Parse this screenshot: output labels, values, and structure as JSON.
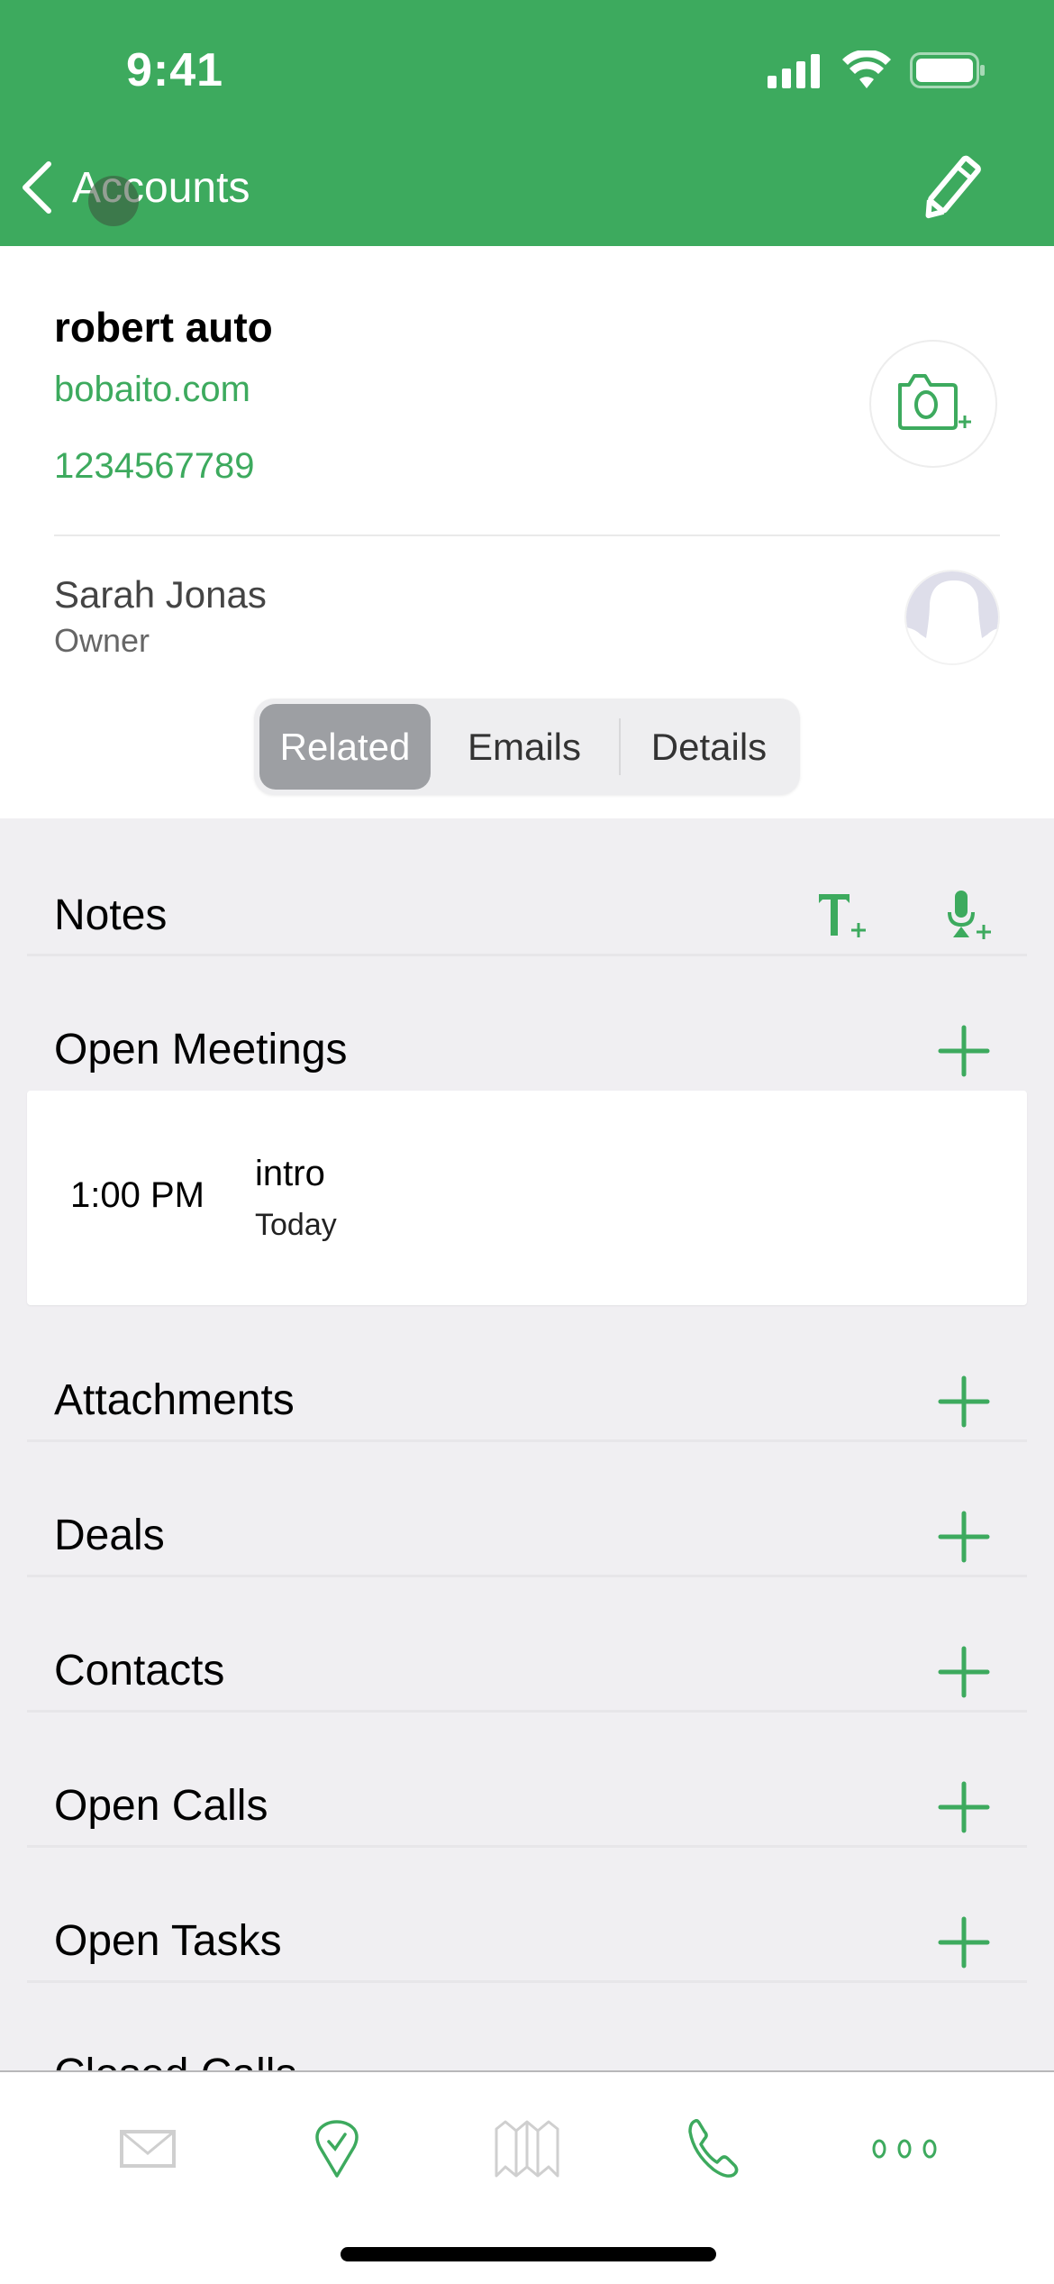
{
  "colors": {
    "brand": "#3DAA5E",
    "background": "#F0EFF2",
    "inactive_icon": "#CFCFCF"
  },
  "status_bar": {
    "time": "9:41",
    "icons": [
      "cellular-signal-icon",
      "wifi-icon",
      "battery-icon"
    ]
  },
  "nav": {
    "back_label": "Accounts",
    "edit_icon": "pencil-icon"
  },
  "account": {
    "name": "robert auto",
    "website": "bobaito.com",
    "phone": "1234567789",
    "photo_button_icon": "camera-add-icon"
  },
  "owner": {
    "name": "Sarah Jonas",
    "role": "Owner",
    "avatar_icon": "person-placeholder-icon"
  },
  "segments": [
    {
      "label": "Related",
      "selected": true
    },
    {
      "label": "Emails",
      "selected": false
    },
    {
      "label": "Details",
      "selected": false
    }
  ],
  "sections": {
    "notes": {
      "title": "Notes",
      "actions": [
        "text-note-add-icon",
        "voice-note-add-icon"
      ]
    },
    "open_meetings": {
      "title": "Open Meetings",
      "items": [
        {
          "time": "1:00 PM",
          "title": "intro",
          "date": "Today"
        }
      ]
    },
    "list": [
      {
        "title": "Attachments"
      },
      {
        "title": "Deals"
      },
      {
        "title": "Contacts"
      },
      {
        "title": "Open Calls"
      },
      {
        "title": "Open Tasks"
      },
      {
        "title": "Closed Calls"
      }
    ]
  },
  "tabbar": [
    {
      "name": "mail",
      "icon": "envelope-icon",
      "active": false
    },
    {
      "name": "check-in",
      "icon": "location-check-icon",
      "active": true
    },
    {
      "name": "map",
      "icon": "map-icon",
      "active": false
    },
    {
      "name": "calls",
      "icon": "phone-icon",
      "active": true
    },
    {
      "name": "more",
      "icon": "more-dots-icon",
      "active": true
    }
  ]
}
